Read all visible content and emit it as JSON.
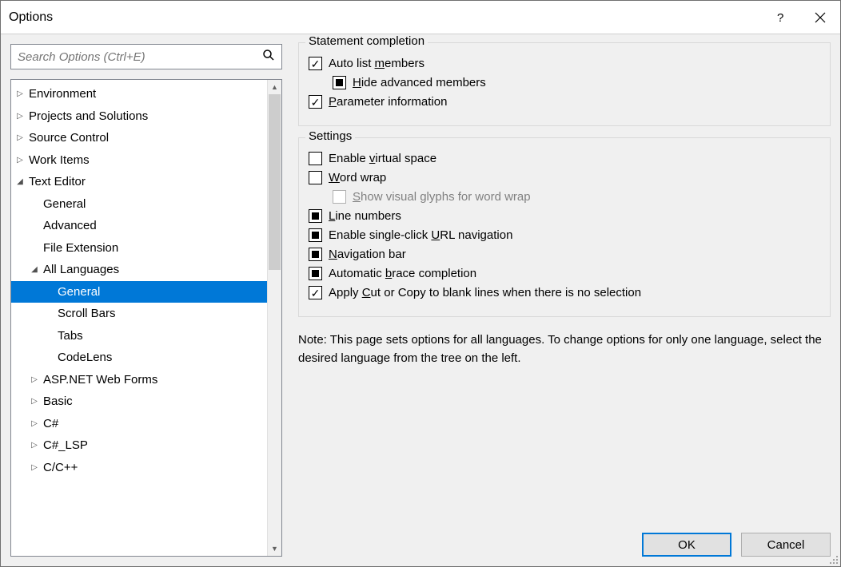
{
  "window": {
    "title": "Options"
  },
  "search": {
    "placeholder": "Search Options (Ctrl+E)"
  },
  "tree": {
    "items": [
      {
        "label": "Environment",
        "depth": 0,
        "expander": "right",
        "selected": false
      },
      {
        "label": "Projects and Solutions",
        "depth": 0,
        "expander": "right",
        "selected": false
      },
      {
        "label": "Source Control",
        "depth": 0,
        "expander": "right",
        "selected": false
      },
      {
        "label": "Work Items",
        "depth": 0,
        "expander": "right",
        "selected": false
      },
      {
        "label": "Text Editor",
        "depth": 0,
        "expander": "down",
        "selected": false
      },
      {
        "label": "General",
        "depth": 1,
        "expander": "none",
        "selected": false
      },
      {
        "label": "Advanced",
        "depth": 1,
        "expander": "none",
        "selected": false
      },
      {
        "label": "File Extension",
        "depth": 1,
        "expander": "none",
        "selected": false
      },
      {
        "label": "All Languages",
        "depth": 1,
        "expander": "down",
        "selected": false
      },
      {
        "label": "General",
        "depth": 2,
        "expander": "none",
        "selected": true
      },
      {
        "label": "Scroll Bars",
        "depth": 2,
        "expander": "none",
        "selected": false
      },
      {
        "label": "Tabs",
        "depth": 2,
        "expander": "none",
        "selected": false
      },
      {
        "label": "CodeLens",
        "depth": 2,
        "expander": "none",
        "selected": false
      },
      {
        "label": "ASP.NET Web Forms",
        "depth": 1,
        "expander": "right",
        "selected": false
      },
      {
        "label": "Basic",
        "depth": 1,
        "expander": "right",
        "selected": false
      },
      {
        "label": "C#",
        "depth": 1,
        "expander": "right",
        "selected": false
      },
      {
        "label": "C#_LSP",
        "depth": 1,
        "expander": "right",
        "selected": false
      },
      {
        "label": "C/C++",
        "depth": 1,
        "expander": "right",
        "selected": false
      }
    ]
  },
  "panel": {
    "group1": {
      "title": "Statement completion",
      "auto_list_pre": "Auto list ",
      "auto_list_u": "m",
      "auto_list_post": "embers",
      "hide_pre": "",
      "hide_u": "H",
      "hide_post": "ide advanced members",
      "param_pre": "",
      "param_u": "P",
      "param_post": "arameter information"
    },
    "group2": {
      "title": "Settings",
      "virtual_pre": "Enable ",
      "virtual_u": "v",
      "virtual_post": "irtual space",
      "wrap_pre": "",
      "wrap_u": "W",
      "wrap_post": "ord wrap",
      "glyphs_pre": "",
      "glyphs_u": "S",
      "glyphs_post": "how visual glyphs for word wrap",
      "linenum_pre": "",
      "linenum_u": "L",
      "linenum_post": "ine numbers",
      "url_pre": "Enable single-click ",
      "url_u": "U",
      "url_post": "RL navigation",
      "nav_pre": "",
      "nav_u": "N",
      "nav_post": "avigation bar",
      "brace_pre": "Automatic ",
      "brace_u": "b",
      "brace_post": "race completion",
      "cut_pre": "Apply ",
      "cut_u": "C",
      "cut_post": "ut or Copy to blank lines when there is no selection"
    },
    "note": "Note: This page sets options for all languages. To change options for only one language, select the desired language from the tree on the left."
  },
  "buttons": {
    "ok": "OK",
    "cancel": "Cancel"
  },
  "checkbox_states": {
    "auto_list": "checked",
    "hide_advanced": "mixed",
    "parameter_info": "checked",
    "virtual_space": "unchecked",
    "word_wrap": "unchecked",
    "show_glyphs": "disabled",
    "line_numbers": "mixed",
    "url_nav": "mixed",
    "nav_bar": "mixed",
    "brace_completion": "mixed",
    "apply_cut": "checked"
  }
}
